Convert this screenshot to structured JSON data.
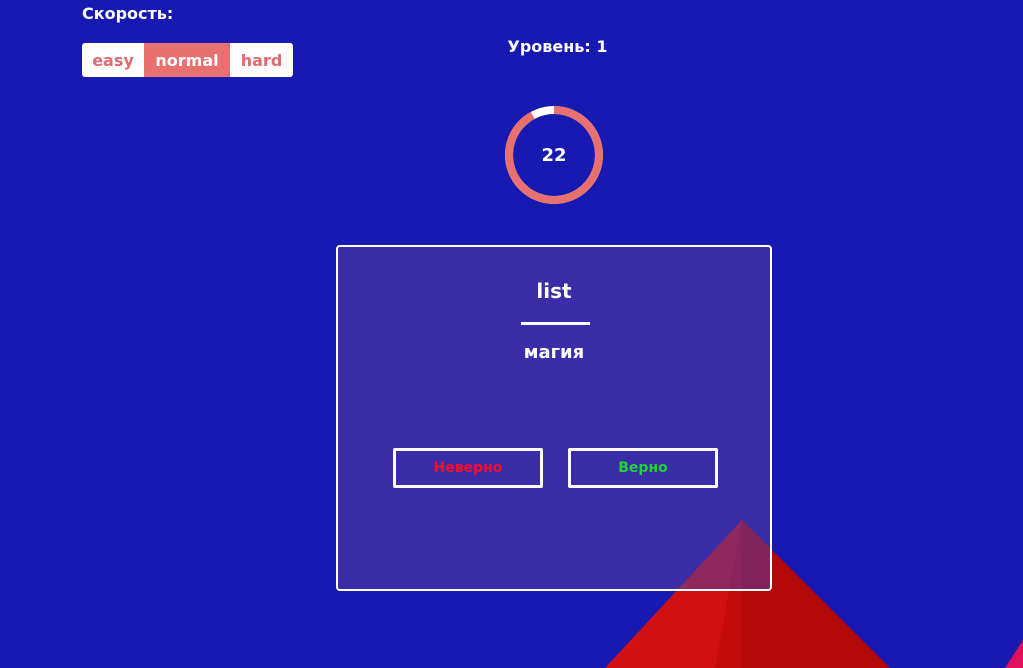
{
  "speed": {
    "label": "Скорость:",
    "options": [
      "easy",
      "normal",
      "hard"
    ],
    "selected": "normal"
  },
  "level": {
    "label": "Уровень: 1"
  },
  "timer": {
    "value": "22",
    "remaining_fraction": 0.92,
    "ring_color": "#e8706f",
    "track_color": "#ffffff"
  },
  "card": {
    "word": "list",
    "translation": "магия",
    "wrong_label": "Неверно",
    "right_label": "Верно",
    "wrong_color": "#ff0a2a",
    "right_color": "#1ed534"
  },
  "colors": {
    "background": "#1719b0",
    "accent": "#e8706f",
    "decoration_red": "#cc0a0a"
  }
}
